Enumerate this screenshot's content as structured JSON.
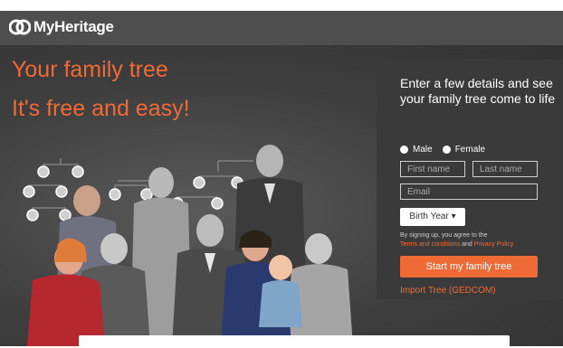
{
  "header": {
    "logo_text": "MyHeritage"
  },
  "hero": {
    "headline_line1": "Your family tree",
    "headline_line2": "It's free and easy!"
  },
  "signup": {
    "title": "Enter a few details and see your family tree come to life",
    "gender_options": [
      "Male",
      "Female"
    ],
    "first_name_placeholder": "First name",
    "last_name_placeholder": "Last name",
    "email_placeholder": "Email",
    "birth_year_label": "Birth Year",
    "terms_prefix": "By signing up, you agree to the",
    "terms_link": "Terms and conditions",
    "terms_and": "and",
    "privacy_link": "Privacy Policy",
    "cta_label": "Start my family tree",
    "import_link": "Import Tree (GEDCOM)"
  },
  "colors": {
    "brand_orange": "#f06a35",
    "header_bg": "#4e4e4e",
    "panel_bg": "#3a3a3a"
  }
}
